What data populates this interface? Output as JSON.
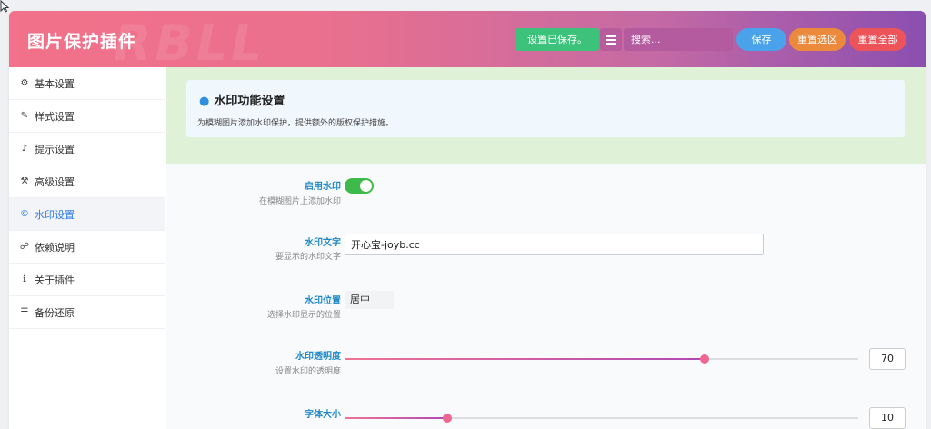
{
  "header": {
    "title": "图片保护插件",
    "watermark": "RBLL",
    "saved_status": "设置已保存。",
    "search_placeholder": "搜索...",
    "save_label": "保存",
    "reset_section_label": "重置选区",
    "reset_all_label": "重置全部",
    "colors": {
      "saved": "#3cc27a",
      "save": "#4aa3ea",
      "reset_section": "#eb8a3c",
      "reset_all": "#ec5459"
    }
  },
  "sidebar": {
    "items": [
      {
        "label": "基本设置",
        "icon": "gear-icon"
      },
      {
        "label": "样式设置",
        "icon": "brush-icon"
      },
      {
        "label": "提示设置",
        "icon": "bell-icon"
      },
      {
        "label": "高级设置",
        "icon": "wrench-icon"
      },
      {
        "label": "水印设置",
        "icon": "copyright-icon",
        "active": true
      },
      {
        "label": "依赖说明",
        "icon": "sitemap-icon"
      },
      {
        "label": "关于插件",
        "icon": "info-icon"
      },
      {
        "label": "备份还原",
        "icon": "database-icon"
      }
    ]
  },
  "section": {
    "title": "水印功能设置",
    "description": "为模糊图片添加水印保护，提供额外的版权保护措施。"
  },
  "fields": {
    "enable": {
      "label": "启用水印",
      "desc": "在模糊图片上添加水印",
      "value": true
    },
    "text": {
      "label": "水印文字",
      "desc": "要显示的水印文字",
      "value": "开心宝-joyb.cc"
    },
    "position": {
      "label": "水印位置",
      "desc": "选择水印显示的位置",
      "value": "居中"
    },
    "opacity": {
      "label": "水印透明度",
      "desc": "设置水印的透明度",
      "value": "70",
      "fraction": 0.7
    },
    "font_size": {
      "label": "字体大小",
      "desc": "",
      "value": "10",
      "fraction": 0.2
    }
  }
}
